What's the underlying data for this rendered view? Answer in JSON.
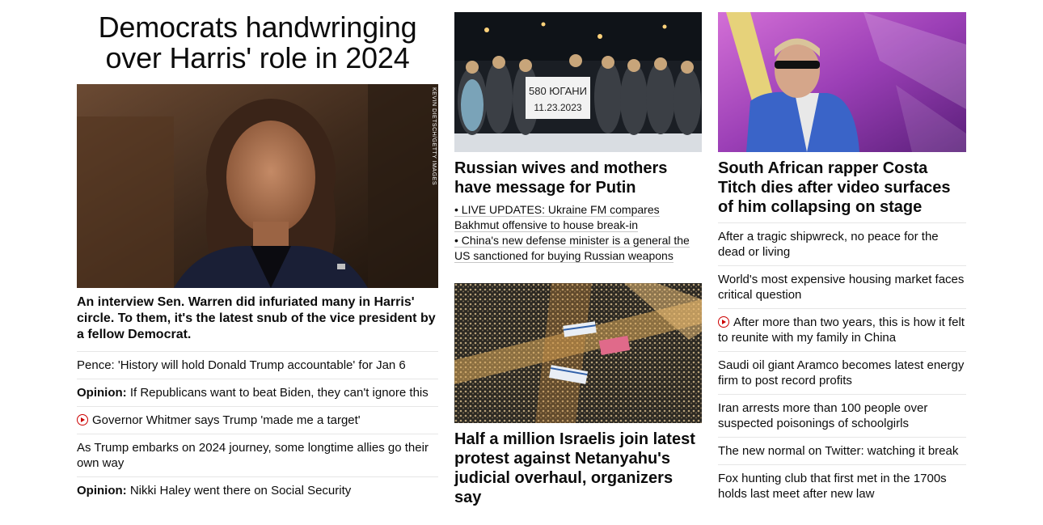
{
  "lead": {
    "title": "Democrats handwringing over Harris' role in 2024",
    "image_credit": "KEVIN DIETSCH/GETTY IMAGES",
    "description": "An interview Sen. Warren did infuriated many in Harris' circle. To them, it's the latest snub of the vice president by a fellow Democrat."
  },
  "left_list": [
    {
      "prefix": "",
      "text": "Pence: 'History will hold Donald Trump accountable' for Jan 6",
      "video": false
    },
    {
      "prefix": "Opinion:",
      "text": " If Republicans want to beat Biden, they can't ignore this",
      "video": false
    },
    {
      "prefix": "",
      "text": "Governor Whitmer says Trump 'made me a target'",
      "video": true
    },
    {
      "prefix": "",
      "text": "As Trump embarks on 2024 journey, some longtime allies go their own way",
      "video": false
    },
    {
      "prefix": "Opinion:",
      "text": " Nikki Haley went there on Social Security",
      "video": false
    }
  ],
  "middle": {
    "card1": {
      "sign_line1": "580 ЮГАНИ",
      "sign_line2": "11.23.2023",
      "title": "Russian wives and mothers have message for Putin",
      "bullets": [
        "• LIVE UPDATES: Ukraine FM compares Bakhmut offensive to house break-in",
        "• China's new defense minister is a general the US sanctioned for buying Russian weapons"
      ]
    },
    "card2": {
      "title": "Half a million Israelis join latest protest against Netanyahu's judicial overhaul, organizers say"
    }
  },
  "right": {
    "card": {
      "title": "South African rapper Costa Titch dies after video surfaces of him collapsing on stage"
    },
    "list": [
      {
        "text": "After a tragic shipwreck, no peace for the dead or living",
        "video": false
      },
      {
        "text": "World's most expensive housing market faces critical question",
        "video": false
      },
      {
        "text": "After more than two years, this is how it felt to reunite with my family in China",
        "video": true
      },
      {
        "text": "Saudi oil giant Aramco becomes latest energy firm to post record profits",
        "video": false
      },
      {
        "text": "Iran arrests more than 100 people over suspected poisonings of schoolgirls",
        "video": false
      },
      {
        "text": "The new normal on Twitter: watching it break",
        "video": false
      },
      {
        "text": "Fox hunting club that first met in the 1700s holds last meet after new law",
        "video": false
      }
    ]
  },
  "colors": {
    "video_red": "#cc0000",
    "divider": "#e6e6e6",
    "text": "#0c0c0c"
  }
}
